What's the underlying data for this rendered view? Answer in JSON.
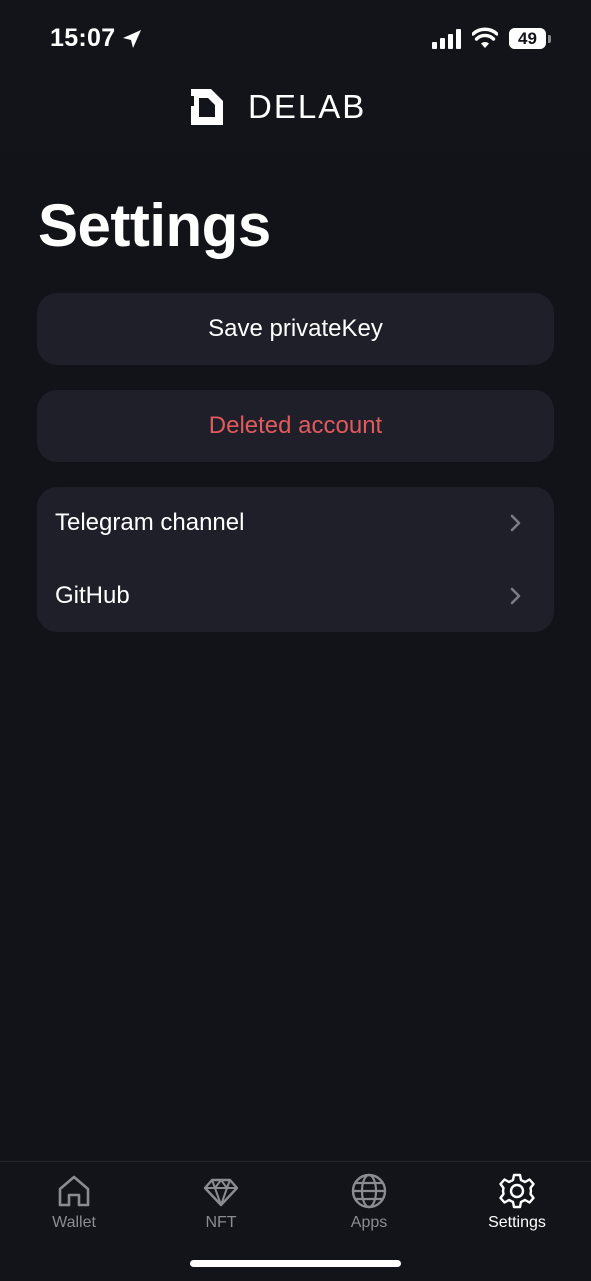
{
  "status_bar": {
    "time": "15:07",
    "battery_percent": "49",
    "battery_level": 0.49,
    "icons": [
      "location-arrow-icon",
      "cellular-signal-icon",
      "wifi-icon",
      "battery-icon"
    ]
  },
  "header": {
    "logo_text": "DELAB",
    "logo_icon": "delab-logo-icon"
  },
  "page": {
    "title": "Settings"
  },
  "actions": {
    "save_label": "Save privateKey",
    "delete_label": "Deleted account",
    "delete_color": "#e05a5e"
  },
  "links": [
    {
      "label": "Telegram channel",
      "icon": "chevron-right-icon"
    },
    {
      "label": "GitHub",
      "icon": "chevron-right-icon"
    }
  ],
  "tab_bar": {
    "active": "Settings",
    "tabs": [
      {
        "label": "Wallet",
        "icon": "home-icon"
      },
      {
        "label": "NFT",
        "icon": "diamond-icon"
      },
      {
        "label": "Apps",
        "icon": "globe-icon"
      },
      {
        "label": "Settings",
        "icon": "gear-icon"
      }
    ]
  },
  "colors": {
    "background": "#121318",
    "card": "#1e1f29",
    "inactive_tab": "#8b8c92",
    "active_tab": "#ffffff"
  }
}
